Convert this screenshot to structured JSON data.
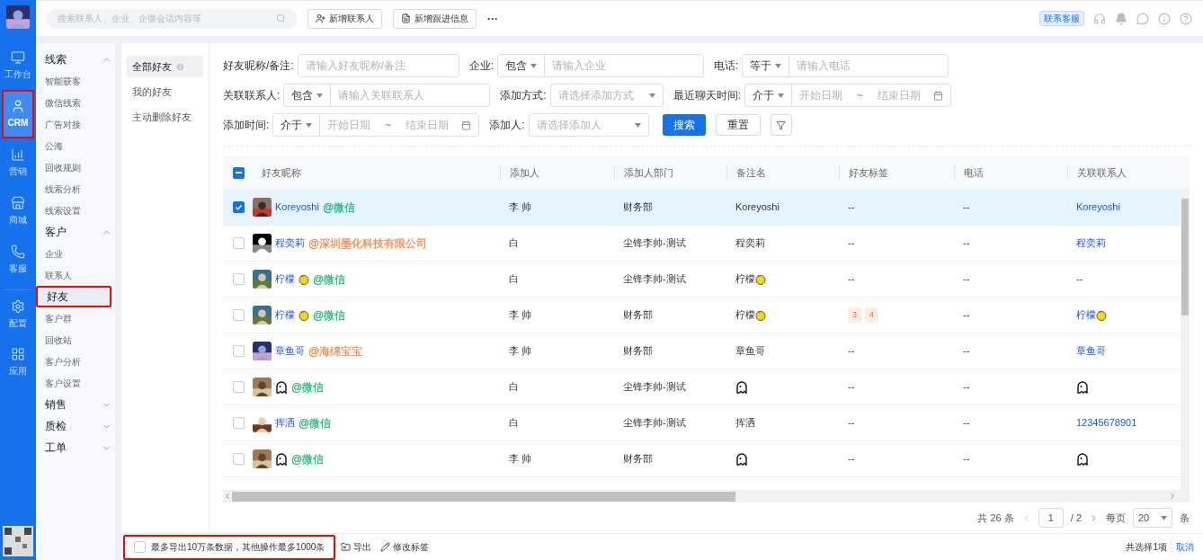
{
  "rail": {
    "items": [
      {
        "label": "工作台",
        "kind": "workbench",
        "selected": false,
        "highlighted": false
      },
      {
        "label": "CRM",
        "kind": "crm",
        "selected": true,
        "highlighted": true
      },
      {
        "label": "营销",
        "kind": "marketing",
        "selected": false,
        "highlighted": false
      },
      {
        "label": "商城",
        "kind": "shop",
        "selected": false,
        "highlighted": false
      },
      {
        "label": "客服",
        "kind": "service",
        "selected": false,
        "highlighted": false
      },
      {
        "label": "配置",
        "kind": "config",
        "selected": false,
        "highlighted": false
      },
      {
        "label": "应用",
        "kind": "apps",
        "selected": false,
        "highlighted": false
      }
    ]
  },
  "topbar": {
    "search_placeholder": "搜索联系人、企业、企微会话内容等",
    "buttons": [
      {
        "label": "新增联系人",
        "kind": "user"
      },
      {
        "label": "新增跟进信息",
        "kind": "doc"
      }
    ],
    "more": "···",
    "support": "联系客服"
  },
  "sidebar": {
    "groups": [
      {
        "label": "线索",
        "expanded": true,
        "items": [
          {
            "label": "智能获客",
            "selected": false,
            "highlighted": false
          },
          {
            "label": "微信线索",
            "selected": false,
            "highlighted": false
          },
          {
            "label": "广告对接",
            "selected": false,
            "highlighted": false
          },
          {
            "label": "公海",
            "selected": false,
            "highlighted": false
          },
          {
            "label": "回收规则",
            "selected": false,
            "highlighted": false
          },
          {
            "label": "线索分析",
            "selected": false,
            "highlighted": false
          },
          {
            "label": "线索设置",
            "selected": false,
            "highlighted": false
          }
        ]
      },
      {
        "label": "客户",
        "expanded": true,
        "items": [
          {
            "label": "企业",
            "selected": false,
            "highlighted": false
          },
          {
            "label": "联系人",
            "selected": false,
            "highlighted": false
          },
          {
            "label": "好友",
            "selected": true,
            "highlighted": true
          },
          {
            "label": "客户群",
            "selected": false,
            "highlighted": false
          },
          {
            "label": "回收站",
            "selected": false,
            "highlighted": false
          },
          {
            "label": "客户分析",
            "selected": false,
            "highlighted": false
          },
          {
            "label": "客户设置",
            "selected": false,
            "highlighted": false
          }
        ]
      },
      {
        "label": "销售",
        "expanded": false
      },
      {
        "label": "质检",
        "expanded": false
      },
      {
        "label": "工单",
        "expanded": false
      }
    ]
  },
  "subtabs": [
    {
      "label": "全部好友",
      "selected": true,
      "info": true
    },
    {
      "label": "我的好友",
      "selected": false,
      "info": false
    },
    {
      "label": "主动删除好友",
      "selected": false,
      "info": false
    }
  ],
  "filters": [
    [
      {
        "kind": "text",
        "label": "好友昵称/备注:",
        "placeholder": "请输入好友昵称/备注"
      },
      {
        "kind": "optext",
        "label": "企业:",
        "op": "包含",
        "placeholder": "请输入企业"
      },
      {
        "kind": "optext",
        "label": "电话:",
        "op": "等于",
        "placeholder": "请输入电话"
      }
    ],
    [
      {
        "kind": "optext",
        "label": "关联联系人:",
        "op": "包含",
        "placeholder": "请输入关联联系人"
      },
      {
        "kind": "select",
        "label": "添加方式:",
        "placeholder": "请选择添加方式"
      },
      {
        "kind": "daterange",
        "label": "最近聊天时间:",
        "op": "介于",
        "start": "开始日期",
        "sep": "~",
        "end": "结束日期"
      }
    ],
    [
      {
        "kind": "daterange",
        "label": "添加时间:",
        "op": "介于",
        "start": "开始日期",
        "sep": "~",
        "end": "结束日期"
      },
      {
        "kind": "selectwide",
        "label": "添加人:",
        "placeholder": "请选择添加人"
      }
    ]
  ],
  "actions": {
    "search": "搜索",
    "reset": "重置"
  },
  "table": {
    "header_checkbox": {
      "indeterminate": true
    },
    "columns": [
      "好友昵称",
      "添加人",
      "添加人部门",
      "备注名",
      "好友标签",
      "电话",
      "关联联系人"
    ],
    "rows": [
      {
        "selected": true,
        "name": "Koreyoshi",
        "source": {
          "text": "@微信",
          "color": "#13b36b"
        },
        "adder": "李 帅",
        "dept": "财务部",
        "remark": "Koreyoshi",
        "tags_empty": "--",
        "phone": "--",
        "contact": "Koreyoshi",
        "contact_link": true
      },
      {
        "selected": false,
        "name": "程奕莉",
        "source": {
          "text": "@深圳墨化科技有限公司",
          "color": "#f5803e"
        },
        "adder": "白",
        "dept": "尘锋李帅-测试",
        "remark": "程奕莉",
        "tags_empty": "--",
        "phone": "--",
        "contact": "程奕莉",
        "contact_link": true
      },
      {
        "selected": false,
        "name": "柠檬",
        "name_icon": {
          "kind": "lemon"
        },
        "source": {
          "text": "@微信",
          "color": "#13b36b"
        },
        "adder": "白",
        "dept": "尘锋李帅-测试",
        "remark": "柠檬",
        "remark_icon": {
          "kind": "lemon"
        },
        "tags_empty": "--",
        "phone": "--",
        "contact": "--",
        "contact_link": false
      },
      {
        "selected": false,
        "name": "柠檬",
        "name_icon": {
          "kind": "lemon"
        },
        "source": {
          "text": "@微信",
          "color": "#13b36b"
        },
        "adder": "李 帅",
        "dept": "财务部",
        "remark": "柠檬",
        "remark_icon": {
          "kind": "lemon"
        },
        "tags": [
          "3",
          "4"
        ],
        "phone": "--",
        "contact": "柠檬",
        "contact_icon": {
          "kind": "lemon"
        },
        "contact_link": true
      },
      {
        "selected": false,
        "name": "章鱼哥",
        "source": {
          "text": "@海绵宝宝",
          "color": "#f5803e"
        },
        "adder": "李 帅",
        "dept": "财务部",
        "remark": "章鱼哥",
        "tags_empty": "--",
        "phone": "--",
        "contact": "章鱼哥",
        "contact_link": true
      },
      {
        "selected": false,
        "name_icon": {
          "kind": "ghost"
        },
        "source": {
          "text": "@微信",
          "color": "#13b36b"
        },
        "adder": "白",
        "dept": "尘锋李帅-测试",
        "remark_icon": {
          "kind": "ghost"
        },
        "tags_empty": "--",
        "phone": "--",
        "contact_icon": {
          "kind": "ghost"
        },
        "contact_link": true
      },
      {
        "selected": false,
        "name": "挥洒",
        "source": {
          "text": "@微信",
          "color": "#13b36b"
        },
        "adder": "白",
        "dept": "尘锋李帅-测试",
        "remark": "挥洒",
        "tags_empty": "--",
        "phone": "--",
        "contact": "12345678901",
        "contact_link": true
      },
      {
        "selected": false,
        "name_icon": {
          "kind": "ghost"
        },
        "source": {
          "text": "@微信",
          "color": "#13b36b"
        },
        "adder": "李 帅",
        "dept": "财务部",
        "remark_icon": {
          "kind": "ghost"
        },
        "tags_empty": "--",
        "phone": "--",
        "contact_icon": {
          "kind": "ghost"
        },
        "contact_link": true
      }
    ]
  },
  "pagination": {
    "total": "共 26 条",
    "page": "1",
    "pages": "/ 2",
    "per_page_label": "每页",
    "per_page": "20",
    "unit": "条"
  },
  "footer": {
    "checked": false,
    "highlighted": true,
    "notice": "最多导出10万条数据，其他操作最多1000条",
    "export": "导出",
    "edit_tags": "修改标签",
    "selected_count": "共选择1项",
    "cancel": "取消"
  }
}
